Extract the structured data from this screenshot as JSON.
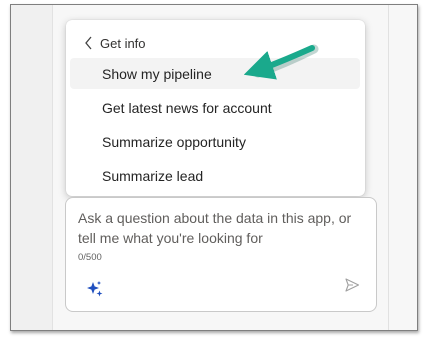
{
  "menu": {
    "header_label": "Get info",
    "items": [
      {
        "label": "Show my pipeline"
      },
      {
        "label": "Get latest news for account"
      },
      {
        "label": "Summarize opportunity"
      },
      {
        "label": "Summarize lead"
      }
    ]
  },
  "chat_input": {
    "placeholder": "Ask a question about the data in this app, or tell me what you're looking for",
    "counter": "0/500"
  },
  "icons": {
    "back": "chevron-left-icon",
    "prompt_guide": "sparkle-icon",
    "send": "send-icon",
    "annotation": "arrow-annotation"
  },
  "colors": {
    "annotation_arrow": "#1aa98c",
    "sparkle": "#1f4fbf",
    "hover_bg": "#f3f3f3"
  }
}
